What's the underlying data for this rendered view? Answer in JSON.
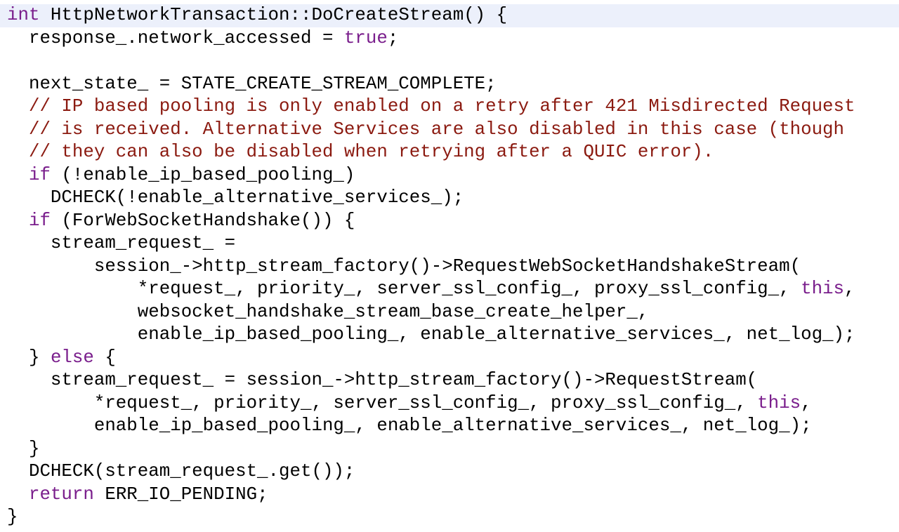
{
  "colors": {
    "keyword": "#7a1e8c",
    "comment": "#8b1a10",
    "highlight": "#ecf0fb"
  },
  "code_lines": [
    [
      {
        "k": "kw",
        "t": "int"
      },
      {
        "k": "",
        "t": " HttpNetworkTransaction::DoCreateStream() {"
      }
    ],
    [
      {
        "k": "",
        "t": "  response_.network_accessed = "
      },
      {
        "k": "kw",
        "t": "true"
      },
      {
        "k": "",
        "t": ";"
      }
    ],
    [],
    [
      {
        "k": "",
        "t": "  next_state_ = STATE_CREATE_STREAM_COMPLETE;"
      }
    ],
    [
      {
        "k": "cm",
        "t": "  // IP based pooling is only enabled on a retry after 421 Misdirected Request"
      }
    ],
    [
      {
        "k": "cm",
        "t": "  // is received. Alternative Services are also disabled in this case (though"
      }
    ],
    [
      {
        "k": "cm",
        "t": "  // they can also be disabled when retrying after a QUIC error)."
      }
    ],
    [
      {
        "k": "",
        "t": "  "
      },
      {
        "k": "kw",
        "t": "if"
      },
      {
        "k": "",
        "t": " (!enable_ip_based_pooling_)"
      }
    ],
    [
      {
        "k": "",
        "t": "    DCHECK(!enable_alternative_services_);"
      }
    ],
    [
      {
        "k": "",
        "t": "  "
      },
      {
        "k": "kw",
        "t": "if"
      },
      {
        "k": "",
        "t": " (ForWebSocketHandshake()) {"
      }
    ],
    [
      {
        "k": "",
        "t": "    stream_request_ ="
      }
    ],
    [
      {
        "k": "",
        "t": "        session_->http_stream_factory()->RequestWebSocketHandshakeStream("
      }
    ],
    [
      {
        "k": "",
        "t": "            *request_, priority_, server_ssl_config_, proxy_ssl_config_, "
      },
      {
        "k": "kw",
        "t": "this"
      },
      {
        "k": "",
        "t": ","
      }
    ],
    [
      {
        "k": "",
        "t": "            websocket_handshake_stream_base_create_helper_,"
      }
    ],
    [
      {
        "k": "",
        "t": "            enable_ip_based_pooling_, enable_alternative_services_, net_log_);"
      }
    ],
    [
      {
        "k": "",
        "t": "  } "
      },
      {
        "k": "kw",
        "t": "else"
      },
      {
        "k": "",
        "t": " {"
      }
    ],
    [
      {
        "k": "",
        "t": "    stream_request_ = session_->http_stream_factory()->RequestStream("
      }
    ],
    [
      {
        "k": "",
        "t": "        *request_, priority_, server_ssl_config_, proxy_ssl_config_, "
      },
      {
        "k": "kw",
        "t": "this"
      },
      {
        "k": "",
        "t": ","
      }
    ],
    [
      {
        "k": "",
        "t": "        enable_ip_based_pooling_, enable_alternative_services_, net_log_);"
      }
    ],
    [
      {
        "k": "",
        "t": "  }"
      }
    ],
    [
      {
        "k": "",
        "t": "  DCHECK(stream_request_.get());"
      }
    ],
    [
      {
        "k": "",
        "t": "  "
      },
      {
        "k": "kw",
        "t": "return"
      },
      {
        "k": "",
        "t": " ERR_IO_PENDING;"
      }
    ],
    [
      {
        "k": "",
        "t": "}"
      }
    ]
  ]
}
